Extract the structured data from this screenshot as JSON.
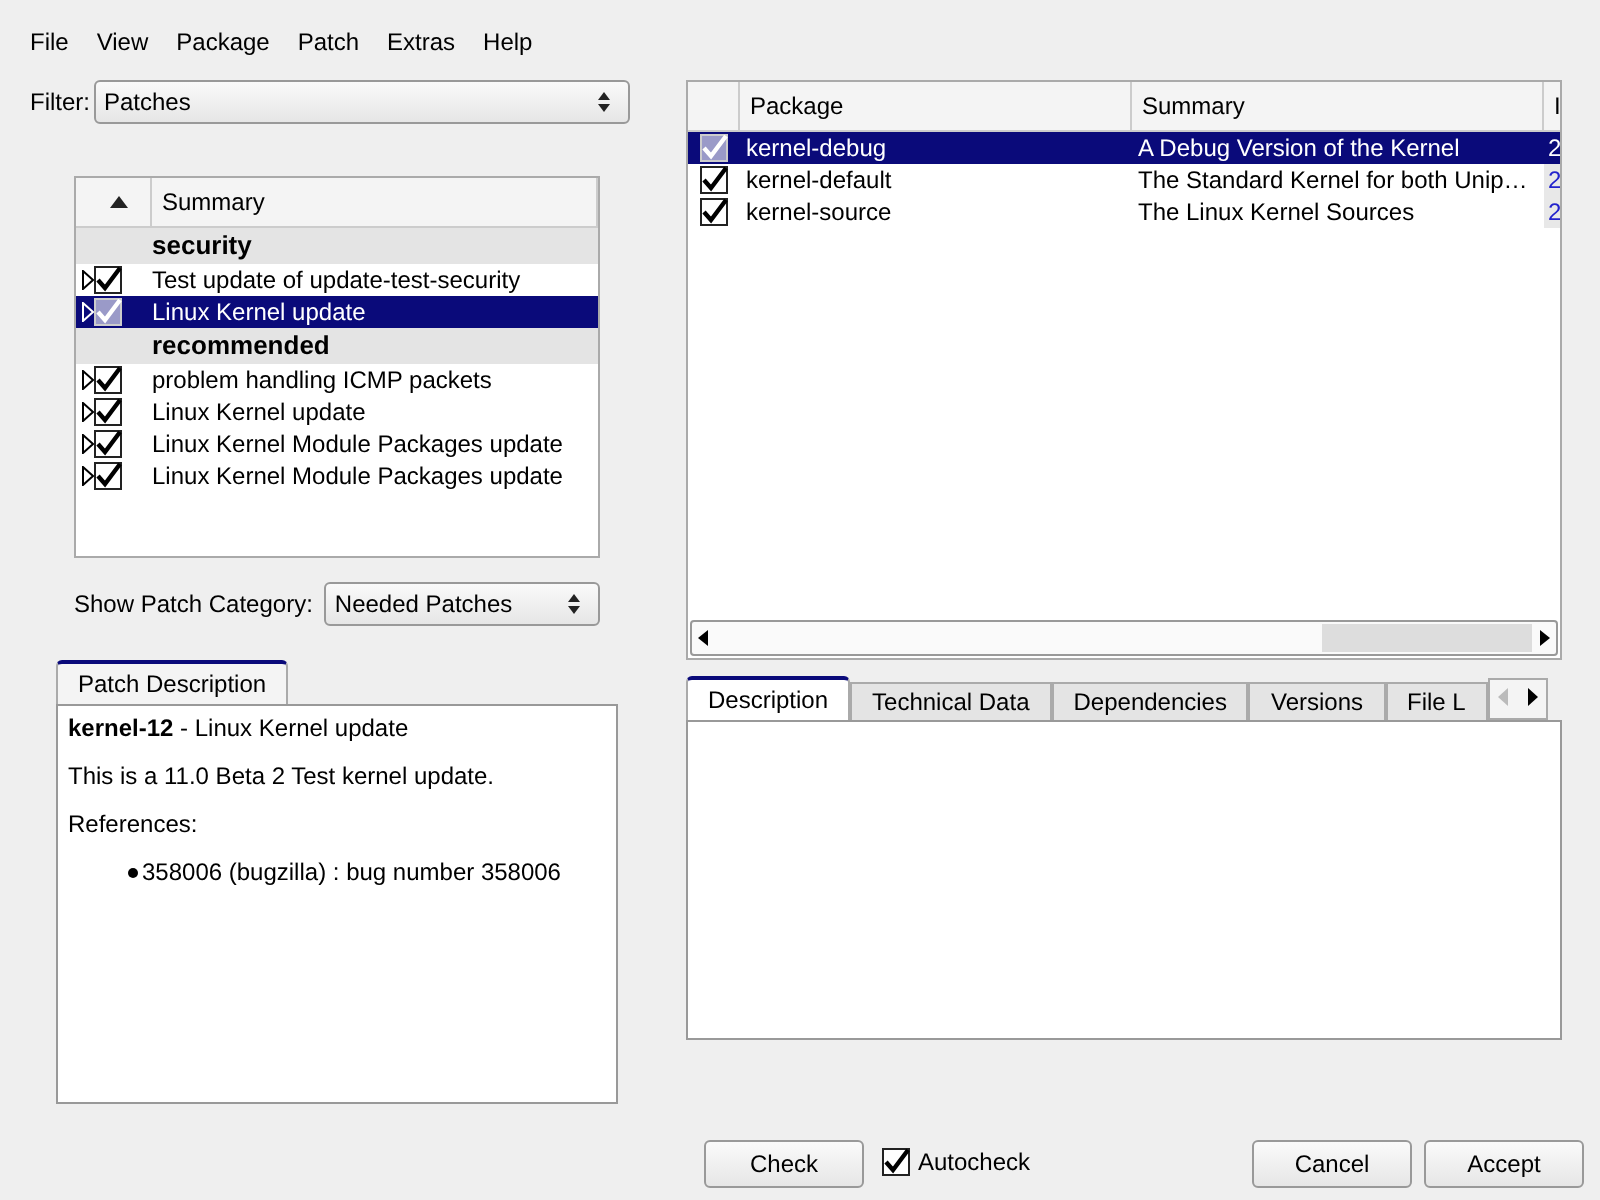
{
  "menu": [
    "File",
    "View",
    "Package",
    "Patch",
    "Extras",
    "Help"
  ],
  "filter": {
    "label": "Filter:",
    "value": "Patches"
  },
  "patch_list": {
    "columns": [
      "Summary"
    ],
    "rows": [
      {
        "kind": "group",
        "summary": "security"
      },
      {
        "kind": "patch",
        "summary": "Test update of update-test-security",
        "checked": true,
        "selected": false
      },
      {
        "kind": "patch",
        "summary": "Linux Kernel update",
        "checked": true,
        "selected": true
      },
      {
        "kind": "group",
        "summary": "recommended"
      },
      {
        "kind": "patch",
        "summary": "problem handling ICMP packets",
        "checked": true,
        "selected": false
      },
      {
        "kind": "patch",
        "summary": "Linux Kernel update",
        "checked": true,
        "selected": false
      },
      {
        "kind": "patch",
        "summary": "Linux Kernel Module Packages update",
        "checked": true,
        "selected": false
      },
      {
        "kind": "patch",
        "summary": "Linux Kernel Module Packages update",
        "checked": true,
        "selected": false
      }
    ]
  },
  "category": {
    "label": "Show Patch Category:",
    "value": "Needed Patches"
  },
  "patch_description": {
    "tab": "Patch Description",
    "title": "**kernel-12** - Linux Kernel update",
    "text": "This is a 11.0 Beta 2 Test kernel update.",
    "references_label": "References:",
    "references": [
      "358006 (bugzilla) : bug number 358006"
    ]
  },
  "package_table": {
    "columns": [
      "Package",
      "Summary",
      "I"
    ],
    "rows": [
      {
        "package": "kernel-debug",
        "summary": "A Debug Version of the Kernel",
        "column_3": "2",
        "checked": true,
        "selected": true
      },
      {
        "package": "kernel-default",
        "summary": "The Standard Kernel for both Unip…",
        "column_3": "2",
        "checked": true,
        "selected": false
      },
      {
        "package": "kernel-source",
        "summary": "The Linux Kernel Sources",
        "column_3": "2",
        "checked": true,
        "selected": false
      }
    ]
  },
  "details_tabs": [
    {
      "label": "Description",
      "selected": true
    },
    {
      "label": "Technical Data",
      "selected": false
    },
    {
      "label": "Dependencies",
      "selected": false
    },
    {
      "label": "Versions",
      "selected": false
    },
    {
      "label": "File L",
      "selected": false
    }
  ],
  "check_button": "Check",
  "autocheck": {
    "label": "Autocheck",
    "checked": true
  },
  "buttons": [
    "Cancel",
    "Accept"
  ]
}
